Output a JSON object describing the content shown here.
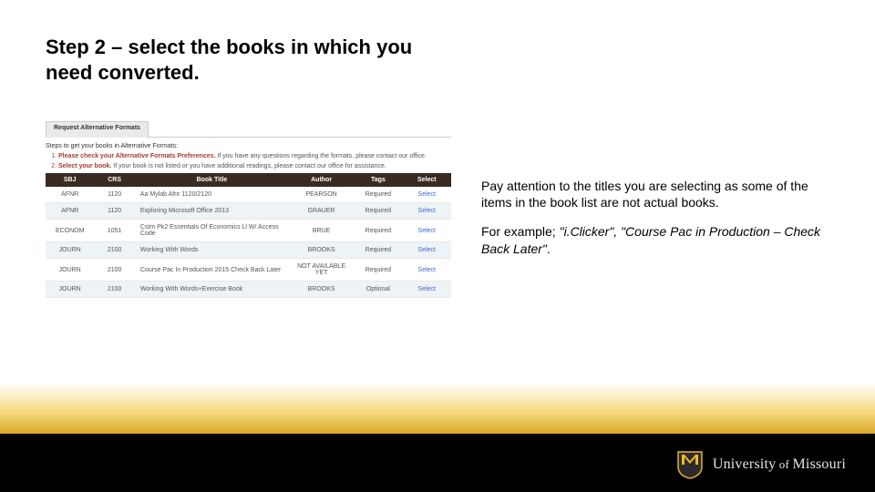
{
  "title": "Step 2 – select the books in which you need converted.",
  "panel": {
    "tab": "Request Alternative Formats",
    "intro": "Steps to get your books in Alternative Formats:",
    "steps": [
      {
        "num": "1.",
        "label": "Please check your Alternative Formats Preferences.",
        "after": " If you have any questions regarding the formats, please contact our office."
      },
      {
        "num": "2.",
        "label": "Select your book.",
        "after": " If your book is not listed or you have additional readings, please contact our office for assistance."
      }
    ],
    "headers": [
      "SBJ",
      "CRS",
      "Book Title",
      "Author",
      "Tags",
      "Select"
    ],
    "rows": [
      {
        "sbj": "AFNR",
        "crs": "1120",
        "title": "Aa Mylab Afnr 1120/2120",
        "author": "PEARSON",
        "tags": "Required",
        "select": "Select"
      },
      {
        "sbj": "AFNR",
        "crs": "1120",
        "title": "Exploring Microsoft Office 2013",
        "author": "GRAUER",
        "tags": "Required",
        "select": "Select"
      },
      {
        "sbj": "ECONOM",
        "crs": "1051",
        "title": "Cstm Pk2 Essentials Of Economics Ll W/ Access Code",
        "author": "BRUE",
        "tags": "Required",
        "select": "Select"
      },
      {
        "sbj": "JOURN",
        "crs": "2100",
        "title": "Working With Words",
        "author": "BROOKS",
        "tags": "Required",
        "select": "Select"
      },
      {
        "sbj": "JOURN",
        "crs": "2100",
        "title": "Course Pac In Production 2015 Check Back Later",
        "author_na_line1": "NOT AVAILABLE",
        "author_na_line2": "YET",
        "tags": "Required",
        "select": "Select"
      },
      {
        "sbj": "JOURN",
        "crs": "2100",
        "title": "Working With Words+Exercise Book",
        "author": "BROOKS",
        "tags": "Optional",
        "select": "Select"
      }
    ]
  },
  "right": {
    "p1": "Pay attention to the titles you are selecting as some of the items in the book list are not actual books.",
    "p2_a": "For example; ",
    "p2_b": "\"i.Clicker\", \"Course Pac in Production – Check Back Later\"",
    "p2_c": "."
  },
  "footer": {
    "university_a": "University",
    "university_of": " of ",
    "university_b": "Missouri"
  }
}
